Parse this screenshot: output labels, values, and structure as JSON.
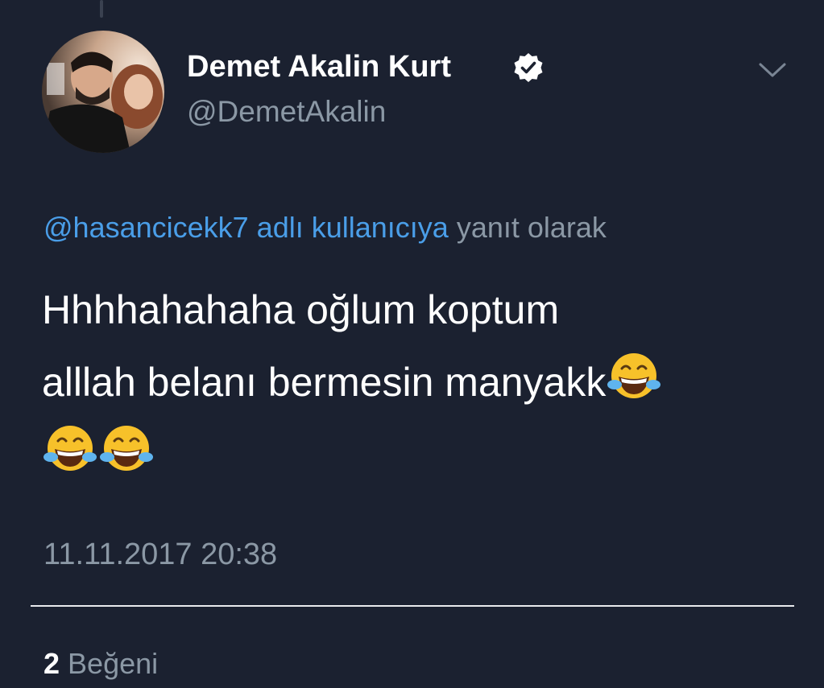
{
  "tweet": {
    "author": {
      "display_name": "Demet Akalin Kurt",
      "handle": "@DemetAkalin",
      "verified": true,
      "verified_icon": "verified-badge-icon",
      "avatar": "profile-photo"
    },
    "menu_icon": "chevron-down-icon",
    "reply_context": {
      "mention": "@hasancicekk7 adlı kullanıcıya",
      "suffix": "yanıt olarak"
    },
    "text": {
      "line1": "Hhhhahahaha oğlum koptum",
      "line2": "alllah belanı bermesin manyakk",
      "emoji": "face-with-tears-of-joy-icon"
    },
    "timestamp": "11.11.2017 20:38",
    "likes": {
      "count": "2",
      "label": "Beğeni"
    }
  },
  "colors": {
    "background": "#1b2130",
    "link": "#4a9ee8",
    "muted": "#8b98a5",
    "text": "#ffffff"
  }
}
